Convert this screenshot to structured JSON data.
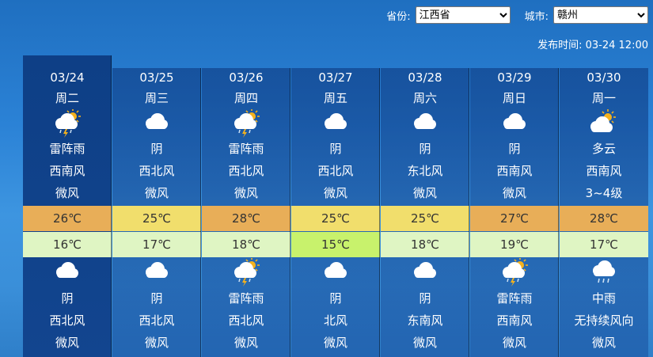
{
  "header": {
    "province_label": "省份:",
    "province_value": "江西省",
    "city_label": "城市:",
    "city_value": "赣州",
    "publish_time": "发布时间: 03-24 12:00"
  },
  "colors": {
    "cloud": "#ffffff",
    "sun": "#f5b21d",
    "rain": "#cfe3f5"
  },
  "days": [
    {
      "date": "03/24",
      "weekday": "周二",
      "day_icon": "thunder-rain-icon",
      "day_weather": "雷阵雨",
      "day_wind_dir": "西南风",
      "day_wind_level": "微风",
      "high": "26℃",
      "high_color": "#e8ae58",
      "low": "16℃",
      "low_color": "#dff5c3",
      "night_icon": "cloudy-icon",
      "night_weather": "阴",
      "night_wind_dir": "西北风",
      "night_wind_level": "微风"
    },
    {
      "date": "03/25",
      "weekday": "周三",
      "day_icon": "cloudy-icon",
      "day_weather": "阴",
      "day_wind_dir": "西北风",
      "day_wind_level": "微风",
      "high": "25℃",
      "high_color": "#f1de6c",
      "low": "17℃",
      "low_color": "#dff5c3",
      "night_icon": "cloudy-icon",
      "night_weather": "阴",
      "night_wind_dir": "西北风",
      "night_wind_level": "微风"
    },
    {
      "date": "03/26",
      "weekday": "周四",
      "day_icon": "thunder-rain-icon",
      "day_weather": "雷阵雨",
      "day_wind_dir": "西北风",
      "day_wind_level": "微风",
      "high": "28℃",
      "high_color": "#e8ae58",
      "low": "18℃",
      "low_color": "#dff5c3",
      "night_icon": "thunder-rain-icon",
      "night_weather": "雷阵雨",
      "night_wind_dir": "西北风",
      "night_wind_level": "微风"
    },
    {
      "date": "03/27",
      "weekday": "周五",
      "day_icon": "cloudy-icon",
      "day_weather": "阴",
      "day_wind_dir": "西北风",
      "day_wind_level": "微风",
      "high": "25℃",
      "high_color": "#f1de6c",
      "low": "15℃",
      "low_color": "#c8f26c",
      "night_icon": "cloudy-icon",
      "night_weather": "阴",
      "night_wind_dir": "北风",
      "night_wind_level": "微风"
    },
    {
      "date": "03/28",
      "weekday": "周六",
      "day_icon": "cloudy-icon",
      "day_weather": "阴",
      "day_wind_dir": "东北风",
      "day_wind_level": "微风",
      "high": "25℃",
      "high_color": "#f1de6c",
      "low": "18℃",
      "low_color": "#dff5c3",
      "night_icon": "cloudy-icon",
      "night_weather": "阴",
      "night_wind_dir": "东南风",
      "night_wind_level": "微风"
    },
    {
      "date": "03/29",
      "weekday": "周日",
      "day_icon": "cloudy-icon",
      "day_weather": "阴",
      "day_wind_dir": "西南风",
      "day_wind_level": "微风",
      "high": "27℃",
      "high_color": "#e8ae58",
      "low": "19℃",
      "low_color": "#dff5c3",
      "night_icon": "thunder-rain-icon",
      "night_weather": "雷阵雨",
      "night_wind_dir": "西南风",
      "night_wind_level": "微风"
    },
    {
      "date": "03/30",
      "weekday": "周一",
      "day_icon": "partly-cloudy-icon",
      "day_weather": "多云",
      "day_wind_dir": "西南风",
      "day_wind_level": "3~4级",
      "high": "28℃",
      "high_color": "#e8ae58",
      "low": "17℃",
      "low_color": "#dff5c3",
      "night_icon": "moderate-rain-icon",
      "night_weather": "中雨",
      "night_wind_dir": "无持续风向",
      "night_wind_level": "微风"
    }
  ]
}
